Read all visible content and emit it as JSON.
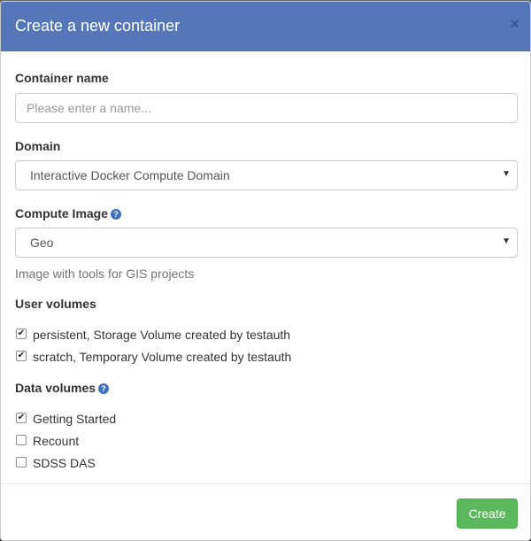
{
  "dialog": {
    "title": "Create a new container",
    "close_glyph": "×"
  },
  "container_name": {
    "label": "Container name",
    "value": "",
    "placeholder": "Please enter a name..."
  },
  "domain": {
    "label": "Domain",
    "selected": "Interactive Docker Compute Domain"
  },
  "compute_image": {
    "label": "Compute Image",
    "selected": "Geo",
    "help_text": "Image with tools for GIS projects"
  },
  "user_volumes": {
    "label": "User volumes",
    "items": [
      {
        "label": "persistent, Storage Volume created by testauth",
        "checked": true
      },
      {
        "label": "scratch, Temporary Volume created by testauth",
        "checked": true
      }
    ]
  },
  "data_volumes": {
    "label": "Data volumes",
    "items": [
      {
        "label": "Getting Started",
        "checked": true
      },
      {
        "label": "Recount",
        "checked": false
      },
      {
        "label": "SDSS DAS",
        "checked": false
      }
    ]
  },
  "footer": {
    "create_label": "Create"
  },
  "icons": {
    "help": "question-circle-icon",
    "caret": "caret-down-icon",
    "check": "checkmark-icon"
  },
  "colors": {
    "header_bg": "#5577b9",
    "primary_button": "#5cb85c",
    "help_icon": "#3f6fc0"
  }
}
